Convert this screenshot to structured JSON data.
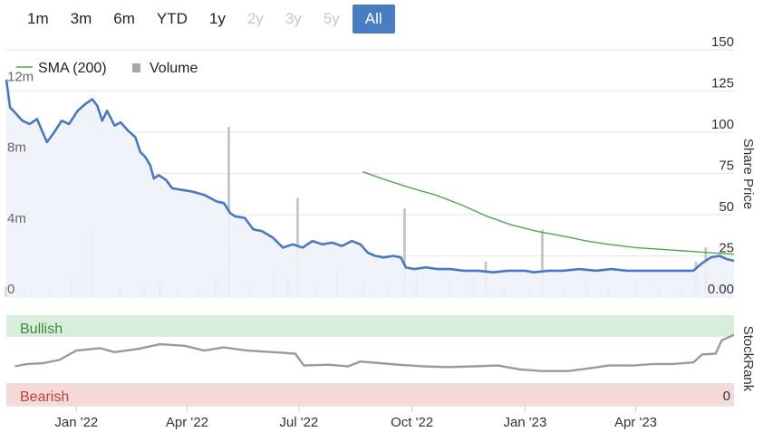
{
  "range_selector": {
    "buttons": [
      {
        "label": "1m",
        "enabled": true
      },
      {
        "label": "3m",
        "enabled": true
      },
      {
        "label": "6m",
        "enabled": true
      },
      {
        "label": "YTD",
        "enabled": true
      },
      {
        "label": "1y",
        "enabled": true
      },
      {
        "label": "2y",
        "enabled": false
      },
      {
        "label": "3y",
        "enabled": false
      },
      {
        "label": "5y",
        "enabled": false
      },
      {
        "label": "All",
        "enabled": true,
        "active": true
      }
    ]
  },
  "colors": {
    "price_line": "#4a78c0",
    "price_fill": "#eef2fa",
    "sma_line": "#4caa4c",
    "volume_bar": "#c8c8cc",
    "bullish_band": "#d8eedd",
    "bearish_band": "#f6d9d9",
    "bullish_text": "#3a8a3a",
    "bearish_text": "#c04040",
    "stockrank_line": "#9a9a9a",
    "active_button": "#4a7cc1"
  },
  "chart_data": [
    {
      "type": "line",
      "legend": [
        "SMA (200)",
        "Volume"
      ],
      "y_right_label": "Share Price",
      "y_right_ticks": [
        "150",
        "125",
        "100",
        "75",
        "50",
        "25",
        "0.00"
      ],
      "y_right_lim": [
        0,
        150
      ],
      "y_left_ticks": [
        "12m",
        "8m",
        "4m",
        "0"
      ],
      "y_left_lim": [
        0,
        16
      ],
      "grid": true,
      "x_range": [
        "2021-11-05",
        "2023-06-20"
      ],
      "series": [
        {
          "name": "",
          "role": "price",
          "points": [
            [
              "2021-11-05",
              132
            ],
            [
              "2021-11-08",
              115
            ],
            [
              "2021-11-12",
              112
            ],
            [
              "2021-11-18",
              107
            ],
            [
              "2021-11-24",
              105
            ],
            [
              "2021-11-30",
              108
            ],
            [
              "2021-12-04",
              101
            ],
            [
              "2021-12-08",
              94
            ],
            [
              "2021-12-14",
              100
            ],
            [
              "2021-12-20",
              107
            ],
            [
              "2021-12-26",
              105
            ],
            [
              "2022-01-02",
              113
            ],
            [
              "2022-01-08",
              117
            ],
            [
              "2022-01-14",
              120
            ],
            [
              "2022-01-18",
              116
            ],
            [
              "2022-01-22",
              107
            ],
            [
              "2022-01-26",
              113
            ],
            [
              "2022-02-01",
              104
            ],
            [
              "2022-02-06",
              106
            ],
            [
              "2022-02-12",
              101
            ],
            [
              "2022-02-18",
              97
            ],
            [
              "2022-02-22",
              88
            ],
            [
              "2022-02-26",
              85
            ],
            [
              "2022-03-02",
              80
            ],
            [
              "2022-03-05",
              72
            ],
            [
              "2022-03-09",
              74
            ],
            [
              "2022-03-15",
              71
            ],
            [
              "2022-03-20",
              66
            ],
            [
              "2022-03-28",
              65
            ],
            [
              "2022-04-05",
              64
            ],
            [
              "2022-04-15",
              62
            ],
            [
              "2022-04-25",
              58
            ],
            [
              "2022-05-01",
              57
            ],
            [
              "2022-05-06",
              51
            ],
            [
              "2022-05-10",
              49
            ],
            [
              "2022-05-18",
              48
            ],
            [
              "2022-05-25",
              41
            ],
            [
              "2022-06-01",
              40
            ],
            [
              "2022-06-10",
              36
            ],
            [
              "2022-06-18",
              30
            ],
            [
              "2022-06-26",
              32
            ],
            [
              "2022-07-04",
              30
            ],
            [
              "2022-07-12",
              34
            ],
            [
              "2022-07-20",
              32
            ],
            [
              "2022-07-28",
              33
            ],
            [
              "2022-08-05",
              31
            ],
            [
              "2022-08-13",
              34
            ],
            [
              "2022-08-20",
              32
            ],
            [
              "2022-08-26",
              27
            ],
            [
              "2022-09-01",
              25
            ],
            [
              "2022-09-08",
              24
            ],
            [
              "2022-09-16",
              25
            ],
            [
              "2022-09-22",
              24
            ],
            [
              "2022-09-26",
              18
            ],
            [
              "2022-10-03",
              17
            ],
            [
              "2022-10-12",
              18
            ],
            [
              "2022-10-22",
              17
            ],
            [
              "2022-11-01",
              17
            ],
            [
              "2022-11-12",
              16
            ],
            [
              "2022-11-24",
              16
            ],
            [
              "2022-12-06",
              15
            ],
            [
              "2022-12-18",
              16
            ],
            [
              "2023-01-01",
              16
            ],
            [
              "2023-01-08",
              15
            ],
            [
              "2023-01-20",
              16
            ],
            [
              "2023-02-01",
              16
            ],
            [
              "2023-02-14",
              17
            ],
            [
              "2023-02-28",
              16
            ],
            [
              "2023-03-12",
              17
            ],
            [
              "2023-03-25",
              16
            ],
            [
              "2023-04-08",
              16
            ],
            [
              "2023-04-22",
              16
            ],
            [
              "2023-05-06",
              16
            ],
            [
              "2023-05-18",
              16
            ],
            [
              "2023-05-24",
              20
            ],
            [
              "2023-06-01",
              24
            ],
            [
              "2023-06-08",
              25
            ],
            [
              "2023-06-14",
              23
            ],
            [
              "2023-06-20",
              22
            ]
          ]
        },
        {
          "name": "SMA (200)",
          "role": "sma",
          "points": [
            [
              "2022-08-22",
              76
            ],
            [
              "2022-09-10",
              71
            ],
            [
              "2022-10-01",
              66
            ],
            [
              "2022-10-20",
              62
            ],
            [
              "2022-11-10",
              56
            ],
            [
              "2022-12-01",
              49
            ],
            [
              "2022-12-20",
              44
            ],
            [
              "2023-01-10",
              40
            ],
            [
              "2023-02-01",
              37
            ],
            [
              "2023-02-20",
              34
            ],
            [
              "2023-03-10",
              32
            ],
            [
              "2023-04-01",
              30
            ],
            [
              "2023-04-20",
              29
            ],
            [
              "2023-05-10",
              28
            ],
            [
              "2023-05-30",
              27
            ],
            [
              "2023-06-20",
              26
            ]
          ]
        },
        {
          "name": "Volume",
          "role": "volume",
          "unit": "m",
          "points": [
            [
              "2021-11-05",
              0.6
            ],
            [
              "2021-11-20",
              0.3
            ],
            [
              "2021-12-10",
              0.4
            ],
            [
              "2021-12-28",
              1.2
            ],
            [
              "2022-01-14",
              3.8
            ],
            [
              "2022-02-05",
              0.5
            ],
            [
              "2022-02-25",
              0.6
            ],
            [
              "2022-03-10",
              0.8
            ],
            [
              "2022-03-25",
              0.4
            ],
            [
              "2022-04-10",
              0.5
            ],
            [
              "2022-04-24",
              1.0
            ],
            [
              "2022-05-05",
              9.6
            ],
            [
              "2022-05-22",
              0.6
            ],
            [
              "2022-06-10",
              1.6
            ],
            [
              "2022-06-22",
              1.0
            ],
            [
              "2022-06-30",
              5.6
            ],
            [
              "2022-07-15",
              0.6
            ],
            [
              "2022-08-01",
              1.6
            ],
            [
              "2022-08-22",
              0.8
            ],
            [
              "2022-09-12",
              0.6
            ],
            [
              "2022-09-25",
              5.0
            ],
            [
              "2022-10-05",
              1.2
            ],
            [
              "2022-11-01",
              0.8
            ],
            [
              "2022-11-20",
              1.0
            ],
            [
              "2022-11-30",
              2.0
            ],
            [
              "2022-12-15",
              0.4
            ],
            [
              "2023-01-05",
              0.5
            ],
            [
              "2023-01-15",
              3.8
            ],
            [
              "2023-02-01",
              0.4
            ],
            [
              "2023-02-20",
              0.8
            ],
            [
              "2023-03-10",
              0.5
            ],
            [
              "2023-04-01",
              0.9
            ],
            [
              "2023-04-20",
              0.5
            ],
            [
              "2023-05-08",
              0.4
            ],
            [
              "2023-05-20",
              2.0
            ],
            [
              "2023-05-28",
              2.8
            ],
            [
              "2023-06-10",
              1.2
            ]
          ]
        }
      ]
    },
    {
      "type": "line",
      "y_right_label": "StockRank",
      "bands": {
        "top": "Bullish",
        "bottom": "Bearish"
      },
      "y_right_ticks": [
        "0"
      ],
      "y_lim": [
        0,
        100
      ],
      "x_ticks": [
        "Jan '22",
        "Apr '22",
        "Jul '22",
        "Oct '22",
        "Jan '23",
        "Apr '23"
      ],
      "series": [
        {
          "name": "",
          "points": [
            [
              "2021-11-12",
              42
            ],
            [
              "2021-11-22",
              45
            ],
            [
              "2021-12-05",
              46
            ],
            [
              "2021-12-18",
              50
            ],
            [
              "2022-01-01",
              62
            ],
            [
              "2022-01-20",
              65
            ],
            [
              "2022-02-01",
              60
            ],
            [
              "2022-02-20",
              64
            ],
            [
              "2022-03-10",
              70
            ],
            [
              "2022-03-30",
              68
            ],
            [
              "2022-04-15",
              62
            ],
            [
              "2022-05-01",
              66
            ],
            [
              "2022-05-20",
              62
            ],
            [
              "2022-06-10",
              60
            ],
            [
              "2022-06-28",
              58
            ],
            [
              "2022-07-05",
              43
            ],
            [
              "2022-07-25",
              44
            ],
            [
              "2022-08-10",
              42
            ],
            [
              "2022-08-20",
              48
            ],
            [
              "2022-09-05",
              46
            ],
            [
              "2022-09-20",
              44
            ],
            [
              "2022-10-10",
              42
            ],
            [
              "2022-10-30",
              41
            ],
            [
              "2022-11-20",
              42
            ],
            [
              "2022-12-10",
              43
            ],
            [
              "2022-12-28",
              38
            ],
            [
              "2023-01-15",
              36
            ],
            [
              "2023-02-05",
              36
            ],
            [
              "2023-02-25",
              40
            ],
            [
              "2023-03-10",
              43
            ],
            [
              "2023-03-30",
              43
            ],
            [
              "2023-04-15",
              45
            ],
            [
              "2023-05-01",
              45
            ],
            [
              "2023-05-18",
              47
            ],
            [
              "2023-05-25",
              57
            ],
            [
              "2023-06-05",
              58
            ],
            [
              "2023-06-10",
              75
            ],
            [
              "2023-06-20",
              82
            ]
          ]
        }
      ]
    }
  ]
}
